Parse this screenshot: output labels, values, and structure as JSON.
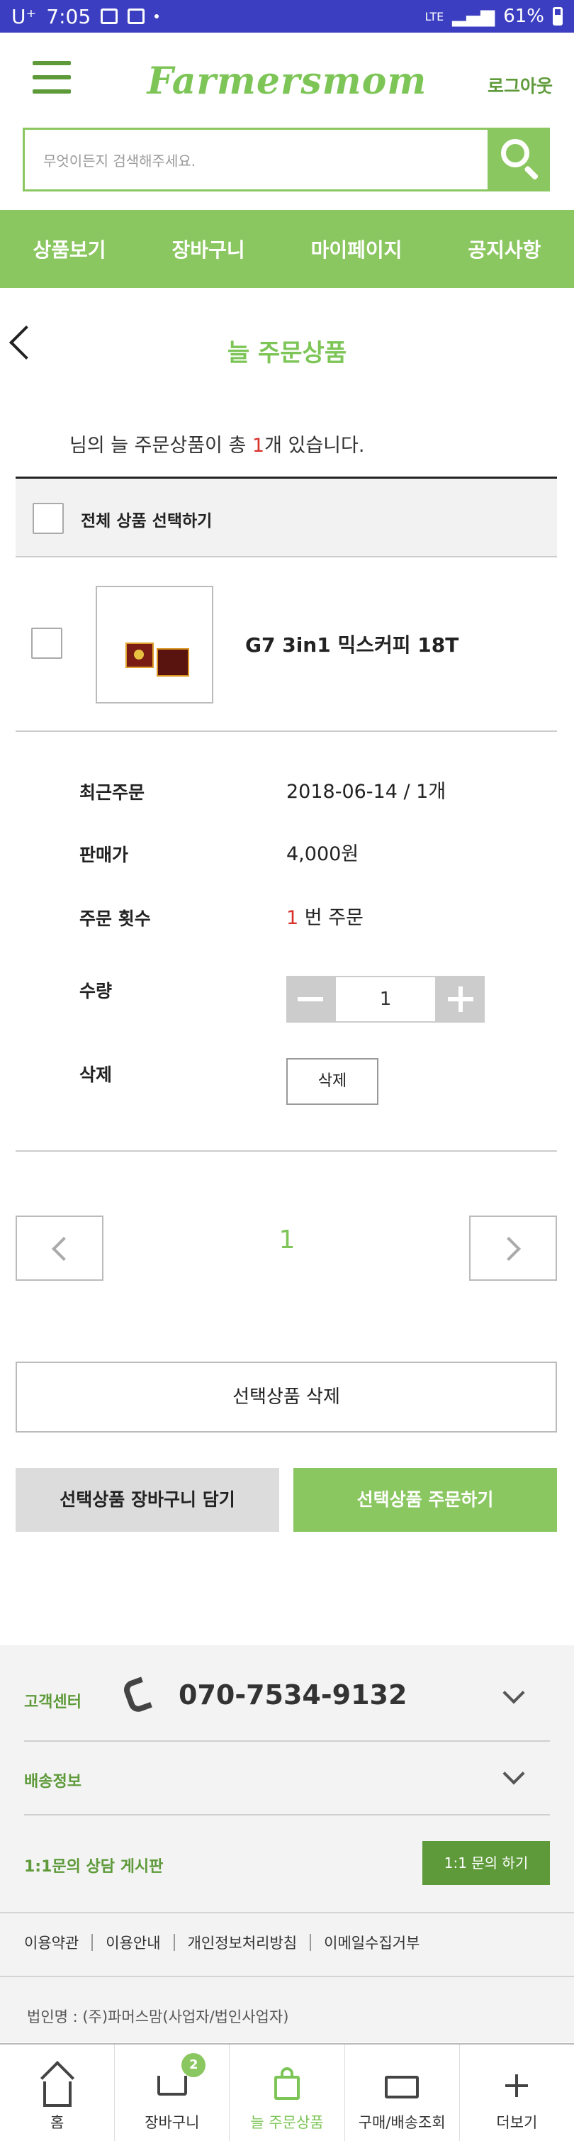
{
  "status_bar": {
    "carrier": "U⁺",
    "time": "7:05",
    "network": "LTE",
    "battery": "61%"
  },
  "header": {
    "logo": "Farmersmom",
    "logout": "로그아웃",
    "search_placeholder": "무엇이든지 검색해주세요."
  },
  "nav": {
    "items": [
      {
        "label": "상품보기"
      },
      {
        "label": "장바구니"
      },
      {
        "label": "마이페이지"
      },
      {
        "label": "공지사항"
      }
    ]
  },
  "page": {
    "title": "늘 주문상품",
    "summary_prefix": "님의 늘 주문상품이 총 ",
    "summary_count": "1",
    "summary_suffix": "개 있습니다.",
    "select_all_label": "전체 상품 선택하기"
  },
  "product": {
    "name": "G7 3in1 믹스커피 18T",
    "details": {
      "recent_order_label": "최근주문",
      "recent_order_value": "2018-06-14 / 1개",
      "price_label": "판매가",
      "price_value": "4,000원",
      "order_count_label": "주문 횟수",
      "order_count_num": "1",
      "order_count_suffix": " 번 주문",
      "quantity_label": "수량",
      "quantity_value": "1",
      "delete_label": "삭제",
      "delete_button": "삭제"
    }
  },
  "pagination": {
    "current_page": "1"
  },
  "actions": {
    "delete_selected": "선택상품 삭제",
    "add_to_cart": "선택상품 장바구니 담기",
    "order_selected": "선택상품 주문하기"
  },
  "footer": {
    "customer_center_label": "고객센터",
    "phone": "070-7534-9132",
    "shipping_label": "배송정보",
    "qna_label": "1:1문의 상담 게시판",
    "qna_button": "1:1 문의 하기",
    "links": [
      {
        "label": "이용약관"
      },
      {
        "label": "이용안내"
      },
      {
        "label": "개인정보처리방침"
      },
      {
        "label": "이메일수집거부"
      }
    ],
    "company": "법인명 : (주)파머스맘(사업자/법인사업자)"
  },
  "tabbar": {
    "items": [
      {
        "label": "홈",
        "icon": "home-icon"
      },
      {
        "label": "장바구니",
        "icon": "cart-icon",
        "badge": "2"
      },
      {
        "label": "늘 주문상품",
        "icon": "bag-icon",
        "active": true
      },
      {
        "label": "구매/배송조회",
        "icon": "truck-icon"
      },
      {
        "label": "더보기",
        "icon": "plus-icon"
      }
    ]
  },
  "colors": {
    "brand_green": "#8bc760",
    "dark_green": "#5e9a3a",
    "accent_red": "#d9312b",
    "status_bar": "#3b3ec0"
  }
}
